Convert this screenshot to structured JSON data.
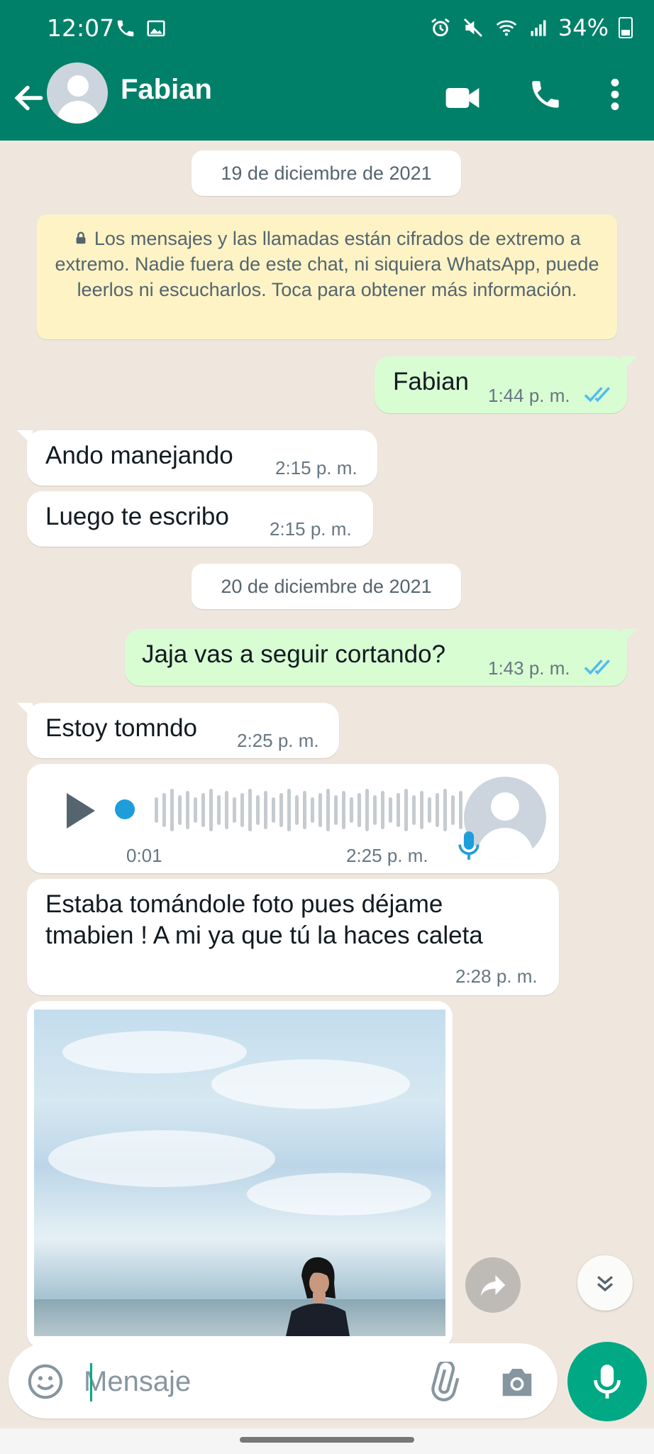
{
  "status_bar": {
    "time": "12:07",
    "battery": "34%"
  },
  "header": {
    "contact_name": "Fabian"
  },
  "date_chips": [
    "19 de diciembre de 2021",
    "20 de diciembre de 2021"
  ],
  "encryption_notice": "Los mensajes y las llamadas están cifrados de extremo a extremo. Nadie fuera de este chat, ni siquiera WhatsApp, puede leerlos ni escucharlos. Toca para obtener más información.",
  "messages": [
    {
      "direction": "out",
      "text": "Fabian",
      "time": "1:44 p. m."
    },
    {
      "direction": "in",
      "text": "Ando manejando",
      "time": "2:15 p. m."
    },
    {
      "direction": "in",
      "text": "Luego te escribo",
      "time": "2:15 p. m."
    },
    {
      "direction": "out",
      "text": "Jaja vas a seguir cortando?",
      "time": "1:43 p. m."
    },
    {
      "direction": "in",
      "text": "Estoy tomndo",
      "time": "2:25 p. m."
    },
    {
      "direction": "in",
      "type": "voice",
      "duration": "0:01",
      "time": "2:25 p. m.",
      "progress": 0
    },
    {
      "direction": "in",
      "text_line1": "Estaba tomándole foto pues déjame",
      "text_line2": "tmabien ! A mi ya que tú la haces caleta",
      "time": "2:28 p. m."
    },
    {
      "direction": "in",
      "type": "image"
    }
  ],
  "input": {
    "placeholder": "Mensaje"
  },
  "colors": {
    "header": "#008069",
    "outgoing_bubble": "#d9fdd3",
    "incoming_bubble": "#ffffff",
    "accent": "#00a884",
    "read_ticks": "#53bdeb"
  }
}
